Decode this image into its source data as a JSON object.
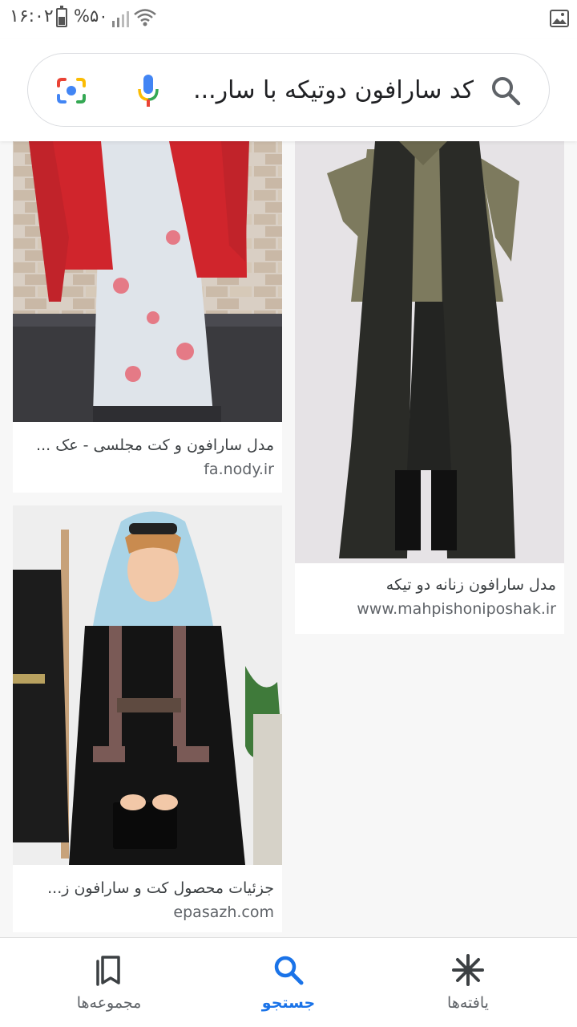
{
  "status_bar": {
    "time": "۱۶:۰۲",
    "battery": "%۵۰",
    "icons": [
      "battery-icon",
      "signal-icon",
      "wifi-icon",
      "gallery-icon"
    ]
  },
  "search": {
    "query": "کد سارافون دوتیکه با سار...",
    "icons": [
      "search-icon",
      "mic-icon",
      "lens-icon"
    ]
  },
  "results": [
    {
      "title": "مدل سارافون و کت مجلسی - عک ...",
      "domain": "fa.nody.ir"
    },
    {
      "title": "مدل سارافون زنانه دو تیکه",
      "domain": "www.mahpishoniposhak.ir"
    },
    {
      "title": "جزئیات محصول کت و سارافون ز...",
      "domain": "epasazh.com"
    }
  ],
  "bottom_nav": {
    "items": [
      {
        "label": "یافته‌ها",
        "icon": "asterisk-icon"
      },
      {
        "label": "جستجو",
        "icon": "search-icon"
      },
      {
        "label": "مجموعه‌ها",
        "icon": "bookmarks-icon"
      }
    ],
    "active_label": "جستجو"
  },
  "colors": {
    "accent": "#1a73e8",
    "text": "#3c4043",
    "domain": "#5f6368"
  }
}
